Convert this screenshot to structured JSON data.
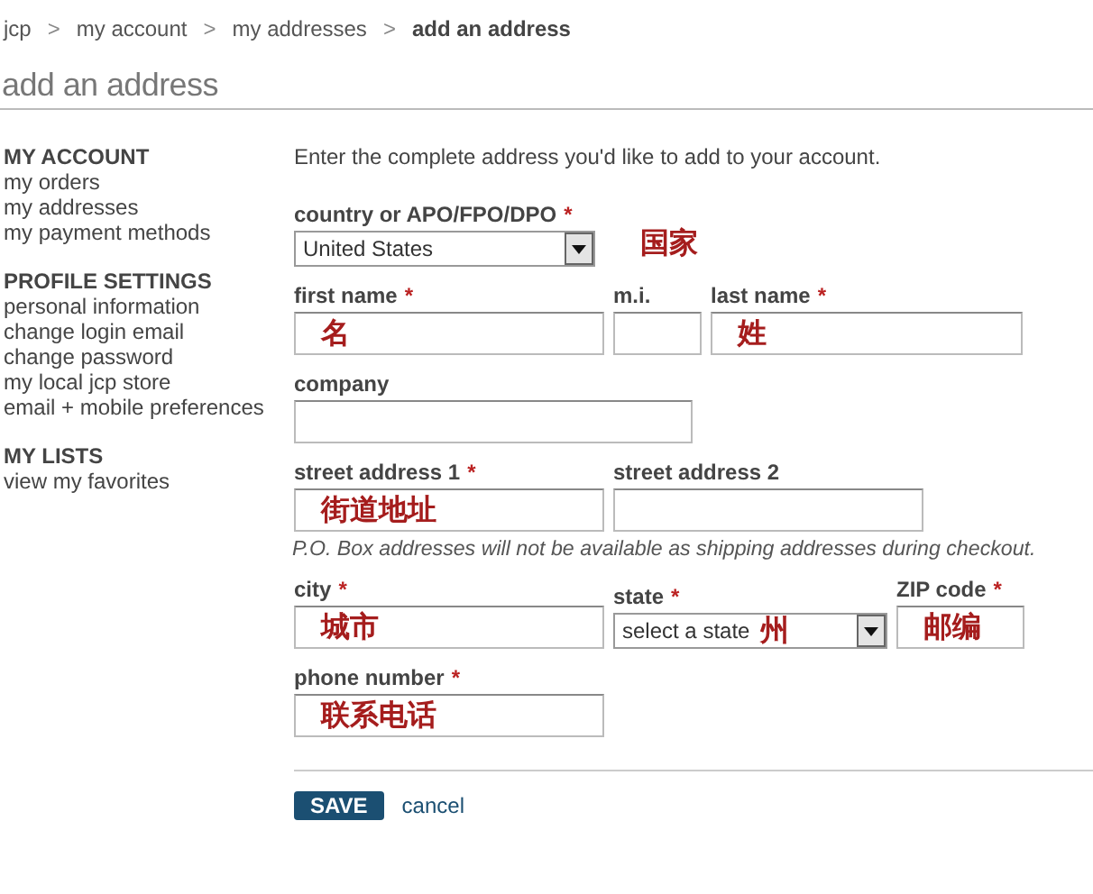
{
  "breadcrumb": [
    {
      "label": "jcp",
      "current": false
    },
    {
      "label": "my account",
      "current": false
    },
    {
      "label": "my addresses",
      "current": false
    },
    {
      "label": "add an address",
      "current": true
    }
  ],
  "breadcrumb_separator": ">",
  "title": "add an address",
  "sidebar": [
    {
      "heading": "MY ACCOUNT",
      "links": [
        "my orders",
        "my addresses",
        "my payment methods"
      ]
    },
    {
      "heading": "PROFILE SETTINGS",
      "links": [
        "personal information",
        "change login email",
        "change password",
        "my local jcp store",
        "email + mobile preferences"
      ]
    },
    {
      "heading": "MY LISTS",
      "links": [
        "view my favorites"
      ]
    }
  ],
  "form": {
    "intro": "Enter the complete address you'd like to add to your account.",
    "rows": [
      {
        "annotation": "国家",
        "fields": [
          {
            "label": "country or APO/FPO/DPO",
            "marker": "*",
            "kind": "select",
            "value": "United States"
          }
        ]
      },
      {
        "fields": [
          {
            "label": "first name",
            "marker": "*",
            "kind": "text",
            "note": "名"
          },
          {
            "label": "m.i.",
            "kind": "text"
          },
          {
            "label": "last name",
            "marker": "*",
            "kind": "text",
            "note": "姓"
          }
        ]
      },
      {
        "fields": [
          {
            "label": "company",
            "kind": "text"
          }
        ]
      },
      {
        "hint": "P.O. Box addresses will not be available as shipping addresses during checkout.",
        "fields": [
          {
            "label": "street address 1",
            "marker": "*",
            "kind": "text",
            "note": "街道地址"
          },
          {
            "label": "street address 2",
            "kind": "text"
          }
        ]
      },
      {
        "fields": [
          {
            "label": "city",
            "marker": "*",
            "kind": "text",
            "note": "城市"
          },
          {
            "label": "state",
            "marker": "*",
            "kind": "select",
            "value": "select a state",
            "note": "州"
          },
          {
            "label": "ZIP code",
            "marker": "*",
            "kind": "text",
            "note": "邮编"
          }
        ]
      },
      {
        "fields": [
          {
            "label": "phone number",
            "marker": "*",
            "kind": "text",
            "note": "联系电话"
          }
        ]
      }
    ],
    "buttons": [
      {
        "label": "SAVE",
        "kind": "primary"
      },
      {
        "label": "cancel",
        "kind": "link"
      }
    ]
  }
}
